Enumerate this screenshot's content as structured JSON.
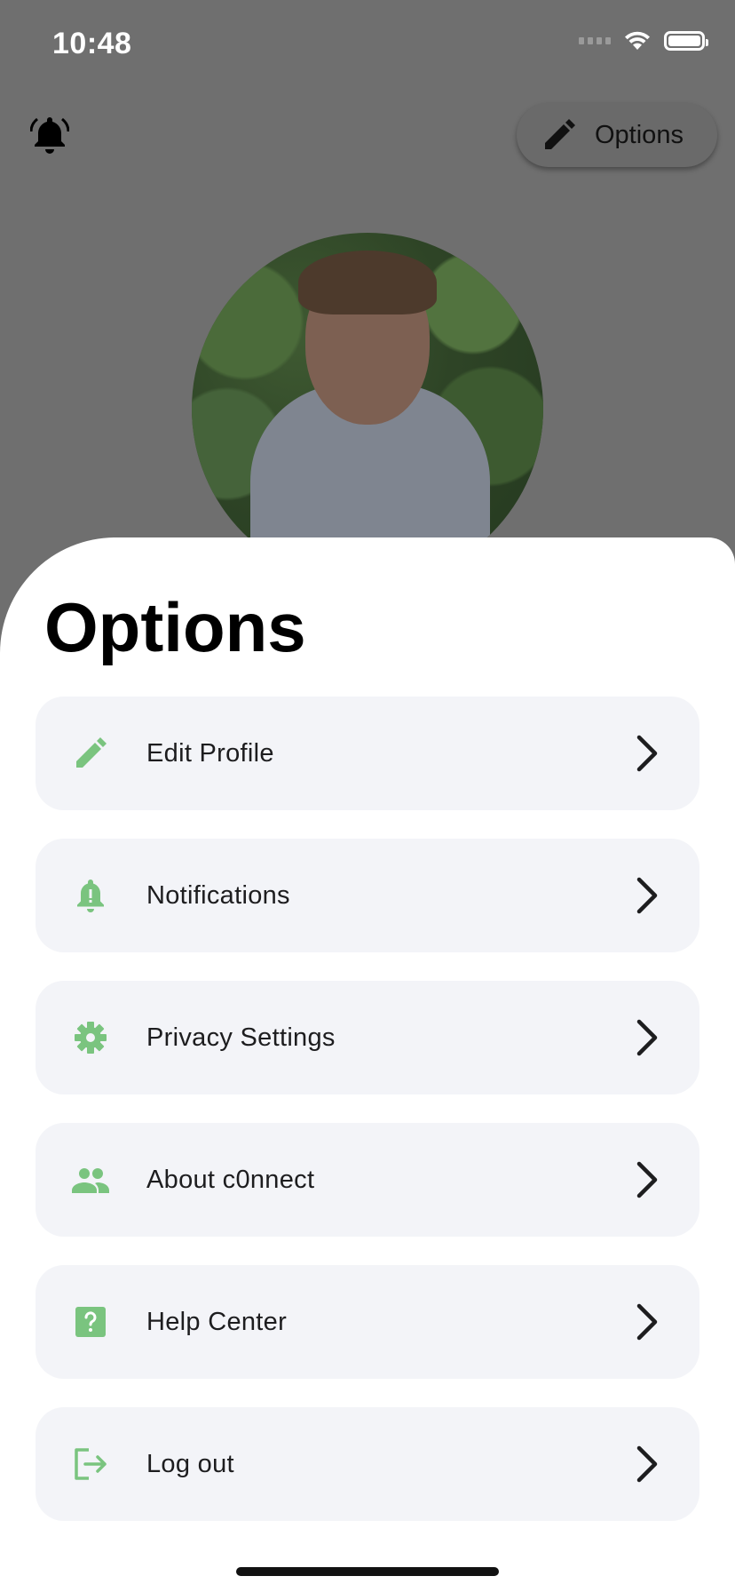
{
  "status_bar": {
    "time": "10:48"
  },
  "header": {
    "options_button_label": "Options"
  },
  "sheet": {
    "title": "Options",
    "items": [
      {
        "label": "Edit Profile",
        "icon": "pencil-icon"
      },
      {
        "label": "Notifications",
        "icon": "bell-icon"
      },
      {
        "label": "Privacy Settings",
        "icon": "gear-icon"
      },
      {
        "label": "About c0nnect",
        "icon": "people-icon"
      },
      {
        "label": "Help Center",
        "icon": "help-icon"
      },
      {
        "label": "Log out",
        "icon": "logout-icon"
      }
    ]
  },
  "colors": {
    "accent": "#7ac47f",
    "overlay": "#6f6f6f",
    "card": "#f3f4f8"
  }
}
